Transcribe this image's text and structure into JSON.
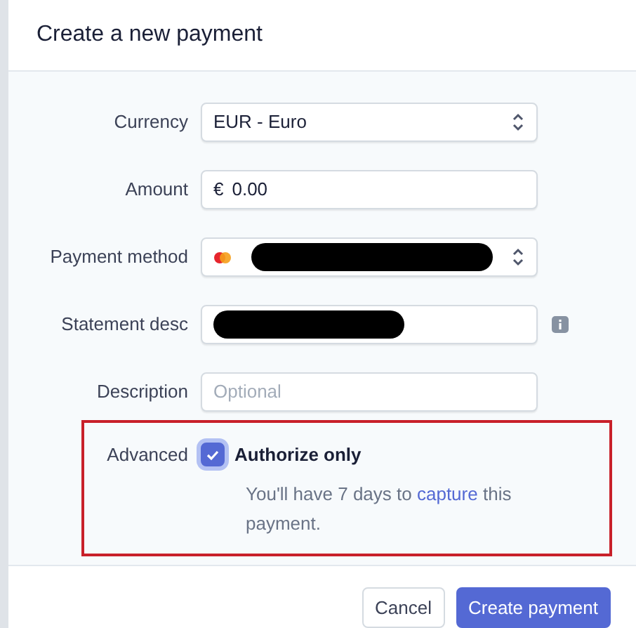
{
  "dialog": {
    "title": "Create a new payment"
  },
  "fields": [
    {
      "label": "Currency",
      "kind": "select",
      "value": "EUR - Euro"
    },
    {
      "label": "Amount",
      "kind": "amount",
      "prefix": "€",
      "value": "0.00"
    },
    {
      "label": "Payment method",
      "kind": "card-select"
    },
    {
      "label": "Statement desc",
      "kind": "redacted",
      "info": true
    },
    {
      "label": "Description",
      "kind": "text",
      "placeholder": "Optional"
    }
  ],
  "advanced": {
    "label": "Advanced",
    "highlighted": true,
    "option": {
      "label": "Authorize only",
      "checked": true
    },
    "hint_before": "You'll have 7 days to",
    "hint_link": "capture",
    "hint_after": "this payment."
  },
  "buttons": [
    {
      "label": "Cancel",
      "kind": "secondary"
    },
    {
      "label": "Create payment",
      "kind": "primary"
    }
  ]
}
